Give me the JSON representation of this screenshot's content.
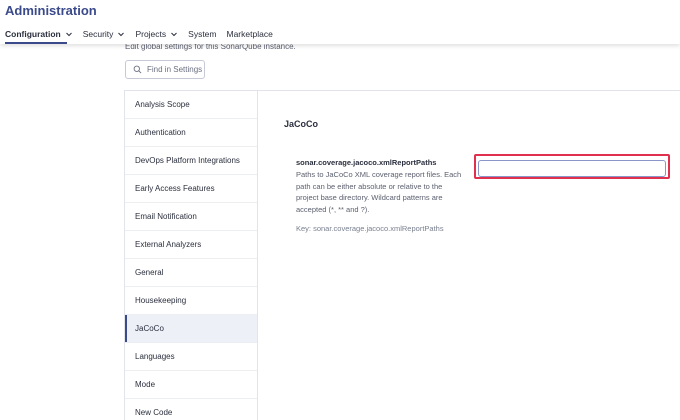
{
  "header": {
    "title": "Administration",
    "nav": [
      {
        "label": "Configuration",
        "has_dropdown": true,
        "active": true
      },
      {
        "label": "Security",
        "has_dropdown": true,
        "active": false
      },
      {
        "label": "Projects",
        "has_dropdown": true,
        "active": false
      },
      {
        "label": "System",
        "has_dropdown": false,
        "active": false
      },
      {
        "label": "Marketplace",
        "has_dropdown": false,
        "active": false
      }
    ]
  },
  "page": {
    "subtitle": "Edit global settings for this SonarQube instance."
  },
  "search": {
    "placeholder": "Find in Settings",
    "value": "",
    "icon": "search-icon"
  },
  "categories": {
    "items": [
      {
        "label": "Analysis Scope"
      },
      {
        "label": "Authentication"
      },
      {
        "label": "DevOps Platform Integrations"
      },
      {
        "label": "Early Access Features"
      },
      {
        "label": "Email Notification"
      },
      {
        "label": "External Analyzers"
      },
      {
        "label": "General"
      },
      {
        "label": "Housekeeping"
      },
      {
        "label": "JaCoCo"
      },
      {
        "label": "Languages"
      },
      {
        "label": "Mode"
      },
      {
        "label": "New Code"
      }
    ],
    "selected": "JaCoCo"
  },
  "panel": {
    "title": "JaCoCo",
    "setting": {
      "key_name": "sonar.coverage.jacoco.xmlReportPaths",
      "description": "Paths to JaCoCo XML coverage report files. Each path can be either absolute or relative to the project base directory. Wildcard patterns are accepted (*, ** and ?).",
      "key_line": "Key: sonar.coverage.jacoco.xmlReportPaths",
      "value": ""
    }
  },
  "colors": {
    "brand": "#3a4a8a",
    "highlight": "#e0304e",
    "selected_bg": "#edf0f7"
  }
}
